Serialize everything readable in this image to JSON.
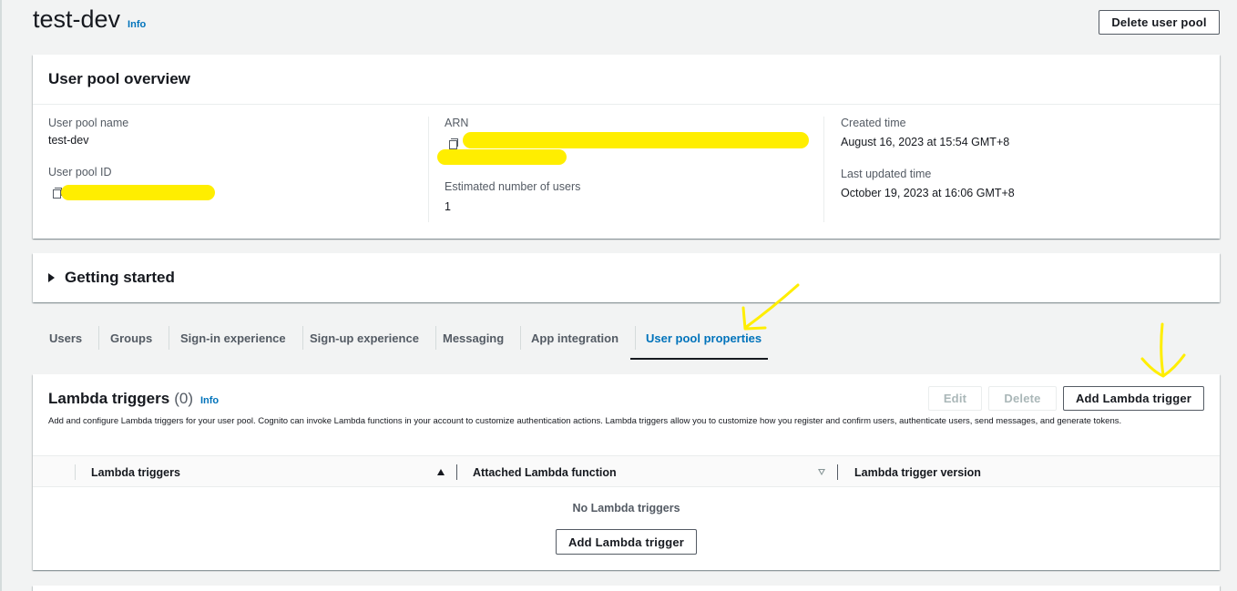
{
  "header": {
    "title": "test-dev",
    "info": "Info",
    "delete_button": "Delete user pool"
  },
  "overview": {
    "title": "User pool overview",
    "pool_name_label": "User pool name",
    "pool_name_value": "test-dev",
    "pool_id_label": "User pool ID",
    "arn_label": "ARN",
    "users_label": "Estimated number of users",
    "users_value": "1",
    "created_label": "Created time",
    "created_value": "August 16, 2023 at 15:54 GMT+8",
    "updated_label": "Last updated time",
    "updated_value": "October 19, 2023 at 16:06 GMT+8"
  },
  "getting_started": {
    "title": "Getting started"
  },
  "tabs": [
    {
      "label": "Users"
    },
    {
      "label": "Groups"
    },
    {
      "label": "Sign-in experience"
    },
    {
      "label": "Sign-up experience"
    },
    {
      "label": "Messaging"
    },
    {
      "label": "App integration"
    },
    {
      "label": "User pool properties",
      "active": true
    }
  ],
  "lambda": {
    "title": "Lambda triggers",
    "count": "(0)",
    "info": "Info",
    "description": "Add and configure Lambda triggers for your user pool. Cognito can invoke Lambda functions in your account to customize authentication actions. Lambda triggers allow you to customize how you register and confirm users, authenticate users, send messages, and generate tokens.",
    "edit_button": "Edit",
    "delete_button": "Delete",
    "add_button": "Add Lambda trigger",
    "columns": [
      "Lambda triggers",
      "Attached Lambda function",
      "Lambda trigger version"
    ],
    "empty_text": "No Lambda triggers",
    "empty_add_button": "Add Lambda trigger"
  },
  "colors": {
    "link": "#0073bb",
    "highlight": "#ffee00",
    "text": "#16191f",
    "muted": "#545b64"
  }
}
